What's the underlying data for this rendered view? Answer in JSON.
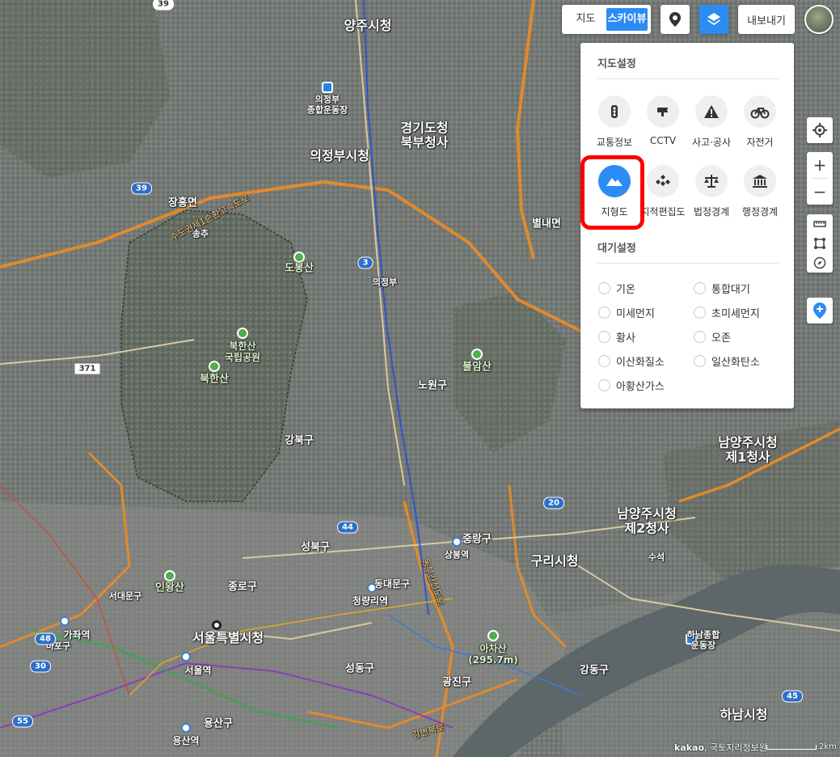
{
  "toolbar": {
    "map_type": [
      "지도",
      "스카이뷰"
    ],
    "selected_map_type": "스카이뷰",
    "poi_icon": "map-pin-icon",
    "layer_icon": "layers-icon",
    "export_label": "내보내기"
  },
  "panel": {
    "map_settings_title": "지도설정",
    "layers": [
      {
        "label": "교통정보",
        "icon": "traffic-light-icon",
        "active": false
      },
      {
        "label": "CCTV",
        "icon": "cctv-icon",
        "active": false
      },
      {
        "label": "사고·공사",
        "icon": "warning-icon",
        "active": false
      },
      {
        "label": "자전거",
        "icon": "bicycle-icon",
        "active": false
      },
      {
        "label": "지형도",
        "icon": "mountain-icon",
        "active": true
      },
      {
        "label": "지적편집도",
        "icon": "cadastral-icon",
        "active": false
      },
      {
        "label": "법정경계",
        "icon": "scales-icon",
        "active": false
      },
      {
        "label": "행정경계",
        "icon": "government-icon",
        "active": false
      }
    ],
    "air_settings_title": "대기설정",
    "air_options": [
      "기온",
      "통합대기",
      "미세먼지",
      "초미세먼지",
      "황사",
      "오존",
      "이산화질소",
      "일산화탄소",
      "아황산가스"
    ]
  },
  "right_controls": {
    "locate_icon": "crosshair-icon",
    "zoom_in": "+",
    "zoom_out": "−",
    "ruler_icon": "ruler-icon",
    "area_icon": "area-icon",
    "compass_icon": "compass-icon",
    "add_pin_icon": "add-pin-icon"
  },
  "map_labels": {
    "yangju": "양주시청",
    "uijeongbu_sports": "의정부\n종합운동장",
    "gyeonggi_north": "경기도청\n북부청사",
    "uijeongbu_city": "의정부시청",
    "jangheung": "장흥면",
    "songchu": "송추",
    "dobongsan": "도봉산",
    "bukhansan_park": "북한산\n국립공원",
    "bukhansan": "북한산",
    "bulamsan": "불암산",
    "gangbuk": "강북구",
    "byeollae": "별내면",
    "namyangju_1": "남양주시청\n제1청사",
    "namyangju_2": "남양주시청\n제2청사",
    "guri": "구리시청",
    "jongno": "종로구",
    "inwangsan": "인왕산",
    "seoul": "서울특별시청",
    "seoul_station": "서울역",
    "yongsan": "용산구",
    "yongsan_station": "용산역",
    "achasan": "아차산\n(295.7m)",
    "gwangjin": "광진구",
    "seongdong": "성동구",
    "hanam": "하남시청",
    "hanam_sports": "하남종합\n운동장",
    "cheongnyangni": "청량리역",
    "dongdaemun": "동대문구",
    "seongbuk": "성북구",
    "sangbong": "상봉역",
    "jungnang": "중랑구",
    "nowon": "노원구",
    "dongducheon_road": "수도권제1순환고속도로",
    "gangbyeon": "강변북로",
    "jungbu_road": "동부간선도로",
    "gajwa": "가좌역",
    "mapo": "마포구",
    "seodaemun": "서대문구",
    "uijeongbu_station": "의정부",
    "sudong": "수석",
    "gwangjin_bridge": "강동구",
    "highway_shield_39": "39",
    "highway_shield_3": "3",
    "highway_shield_371": "371",
    "highway_shield_44": "44",
    "highway_shield_48": "48",
    "highway_shield_30": "30",
    "highway_shield_20": "20",
    "highway_shield_55": "55",
    "highway_shield_45": "45"
  },
  "footer": {
    "brand": "kakao",
    "credit": "국토지리정보원",
    "scale": "2km"
  },
  "colors": {
    "accent": "#2c8cf4",
    "highlight": "#ff0000",
    "terrain": "#6f7470"
  }
}
